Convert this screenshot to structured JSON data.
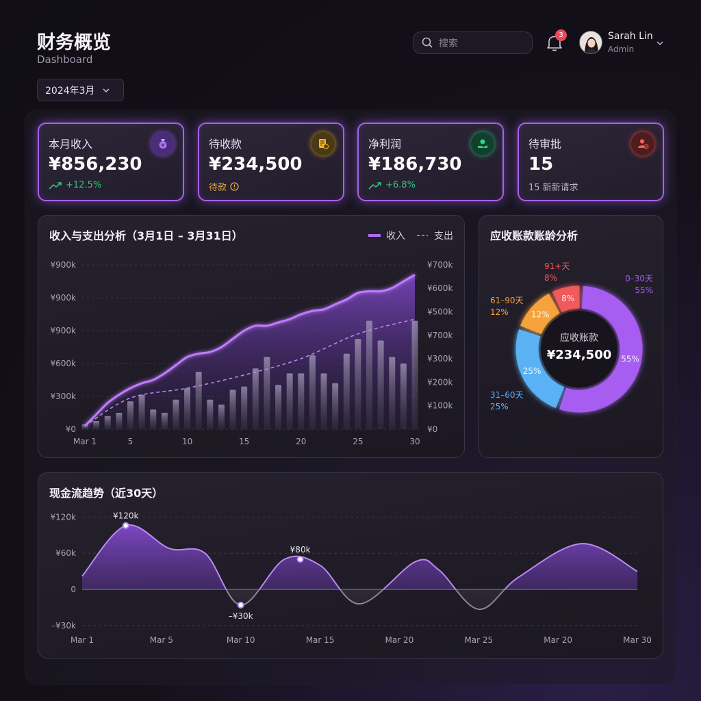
{
  "header": {
    "title": "财务概览",
    "subtitle": "Dashboard",
    "date_select": "2024年3月",
    "search_placeholder": "搜索",
    "notification_count": "3",
    "user": {
      "name": "Sarah Lin",
      "role": "Admin"
    }
  },
  "kpis": [
    {
      "label": "本月收入",
      "value": "¥856,230",
      "sub": "+12.5%",
      "icon": "money-bag-icon",
      "color": "#8a4fe0"
    },
    {
      "label": "待收款",
      "value": "¥234,500",
      "sub": "待款",
      "icon": "invoice-pending-icon",
      "color": "#f0b429"
    },
    {
      "label": "净利润",
      "value": "¥186,730",
      "sub": "+6.8%",
      "icon": "profit-hand-icon",
      "color": "#1fb57a"
    },
    {
      "label": "待审批",
      "value": "15",
      "sub": "15 新新请求",
      "icon": "user-check-icon",
      "color": "#e0463f"
    }
  ],
  "income_chart": {
    "title": "收入与支出分析（3月1日 – 3月31日）",
    "legend_income": "收入",
    "legend_expense": "支出"
  },
  "aging_chart": {
    "title": "应收账款账龄分析",
    "center_label": "应收账款",
    "center_value": "¥234,500"
  },
  "cashflow_chart": {
    "title": "现金流趋势（近30天）"
  },
  "chart_data": [
    {
      "type": "area",
      "title": "收入与支出分析（3月1日 – 3月31日）",
      "left_ticks": [
        "¥0",
        "¥300k",
        "¥600k",
        "¥900k",
        "¥900k",
        "¥900k"
      ],
      "right_ticks": [
        "¥0",
        "¥100k",
        "¥200k",
        "¥300k",
        "¥700k",
        "¥500k",
        "¥600k",
        "¥700k"
      ],
      "x_ticks": [
        {
          "x": 1,
          "label": "Mar 1"
        },
        {
          "x": 5,
          "label": "5"
        },
        {
          "x": 10,
          "label": "10"
        },
        {
          "x": 15,
          "label": "15"
        },
        {
          "x": 20,
          "label": "20"
        },
        {
          "x": 25,
          "label": "25"
        },
        {
          "x": 30,
          "label": "30"
        }
      ],
      "grid": true,
      "series": [
        {
          "name": "收入",
          "kind": "area",
          "x": [
            1,
            2,
            3,
            4,
            5,
            6,
            7,
            8,
            9,
            10,
            11,
            12,
            13,
            14,
            15,
            16,
            17,
            18,
            19,
            20,
            21,
            22,
            23,
            24,
            25,
            26,
            27,
            28,
            29,
            30
          ],
          "values": [
            0.02,
            0.09,
            0.16,
            0.21,
            0.25,
            0.28,
            0.3,
            0.34,
            0.39,
            0.44,
            0.46,
            0.47,
            0.5,
            0.55,
            0.6,
            0.63,
            0.63,
            0.65,
            0.67,
            0.7,
            0.72,
            0.73,
            0.76,
            0.79,
            0.83,
            0.84,
            0.84,
            0.86,
            0.9,
            0.94
          ]
        },
        {
          "name": "支出",
          "kind": "dashed-line",
          "x": [
            1,
            5,
            10,
            15,
            20,
            25,
            30
          ],
          "values": [
            0.02,
            0.19,
            0.25,
            0.33,
            0.43,
            0.58,
            0.67
          ]
        },
        {
          "name": "bars",
          "kind": "bar",
          "x": [
            1,
            2,
            3,
            4,
            5,
            6,
            7,
            8,
            9,
            10,
            11,
            12,
            13,
            14,
            15,
            16,
            17,
            18,
            19,
            20,
            21,
            22,
            23,
            24,
            25,
            26,
            27,
            28,
            29,
            30
          ],
          "values": [
            0.03,
            0.05,
            0.08,
            0.1,
            0.17,
            0.21,
            0.12,
            0.1,
            0.18,
            0.25,
            0.35,
            0.18,
            0.15,
            0.24,
            0.26,
            0.37,
            0.44,
            0.27,
            0.34,
            0.34,
            0.45,
            0.34,
            0.28,
            0.46,
            0.55,
            0.66,
            0.54,
            0.44,
            0.4,
            0.66
          ]
        }
      ]
    },
    {
      "type": "pie",
      "title": "应收账款账龄分析",
      "slices": [
        {
          "label": "0–30天",
          "value": 55,
          "color": "#a65df0"
        },
        {
          "label": "31–60天",
          "value": 25,
          "color": "#5ab2f5"
        },
        {
          "label": "61–90天",
          "value": 12,
          "color": "#f6a33a"
        },
        {
          "label": "91+天",
          "value": 8,
          "color": "#f05a5a"
        }
      ]
    },
    {
      "type": "area",
      "title": "现金流趋势（近30天）",
      "y_ticks": [
        {
          "v": 120,
          "label": "¥120k"
        },
        {
          "v": 60,
          "label": "¥60k"
        },
        {
          "v": 0,
          "label": "0"
        },
        {
          "v": -60,
          "label": "–¥30k"
        }
      ],
      "x_ticks": [
        "Mar 1",
        "Mar 5",
        "Mar 10",
        "Mar 15",
        "Mar 20",
        "Mar 25",
        "Mar 20",
        "Mar 30"
      ],
      "grid": true,
      "points": [
        {
          "i": 0,
          "v": 22
        },
        {
          "i": 0.55,
          "v": 106
        },
        {
          "i": 1.1,
          "v": 68
        },
        {
          "i": 1.55,
          "v": 60
        },
        {
          "i": 2.0,
          "v": -26
        },
        {
          "i": 2.55,
          "v": 50
        },
        {
          "i": 3.0,
          "v": 40
        },
        {
          "i": 3.5,
          "v": -24
        },
        {
          "i": 4.2,
          "v": 46
        },
        {
          "i": 4.5,
          "v": 32
        },
        {
          "i": 5.0,
          "v": -33
        },
        {
          "i": 5.5,
          "v": 20
        },
        {
          "i": 6.3,
          "v": 76
        },
        {
          "i": 7.0,
          "v": 30
        }
      ],
      "annotations": [
        {
          "i": 0.55,
          "v": 106,
          "label": "¥120k",
          "pos": "above"
        },
        {
          "i": 2.0,
          "v": -26,
          "label": "–¥30k",
          "pos": "below"
        },
        {
          "i": 2.75,
          "v": 50,
          "label": "¥80k",
          "pos": "above"
        }
      ]
    }
  ]
}
